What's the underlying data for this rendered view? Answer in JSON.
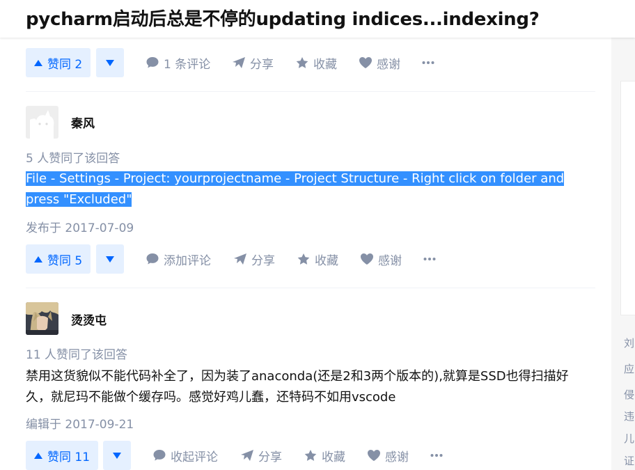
{
  "question": {
    "title": "pycharm启动后总是不停的updating indices...indexing?"
  },
  "first_answer_actions": {
    "upvote_label": "赞同 2",
    "comment_label": "1 条评论",
    "share_label": "分享",
    "collect_label": "收藏",
    "thanks_label": "感谢"
  },
  "answers": [
    {
      "author": "秦风",
      "vote_summary": "5 人赞同了该回答",
      "content_line1": "File - Settings - Project: yourprojectname - Project Structure - Right click on folder and",
      "content_line2": "press \"Excluded\"",
      "time_label": "发布于 2017-07-09",
      "actions": {
        "upvote_label": "赞同 5",
        "comment_label": "添加评论",
        "share_label": "分享",
        "collect_label": "收藏",
        "thanks_label": "感谢"
      }
    },
    {
      "author": "烫烫屯",
      "vote_summary": "11 人赞同了该回答",
      "content_line1": "禁用这货貌似不能代码补全了，因为装了anaconda(还是2和3两个版本的),就算是SSD也得扫描好",
      "content_line2": "久，就尼玛不能做个缓存吗。感觉好鸡儿蠢，还特码不如用vscode",
      "time_label": "编辑于 2017-09-21",
      "actions": {
        "upvote_label": "赞同 11",
        "comment_label": "收起评论",
        "share_label": "分享",
        "collect_label": "收藏",
        "thanks_label": "感谢"
      }
    }
  ],
  "sidebar_fragments": [
    "刘",
    "应",
    "侵",
    "违",
    "儿",
    "证"
  ],
  "colors": {
    "brand_blue": "#0066ff",
    "vote_bg": "#e5f0ff",
    "meta_gray": "#8590a6",
    "selection": "#3390ff"
  },
  "icons": [
    "comment-icon",
    "share-icon",
    "star-icon",
    "heart-icon",
    "more-icon",
    "caret-up-icon",
    "caret-down-icon"
  ]
}
